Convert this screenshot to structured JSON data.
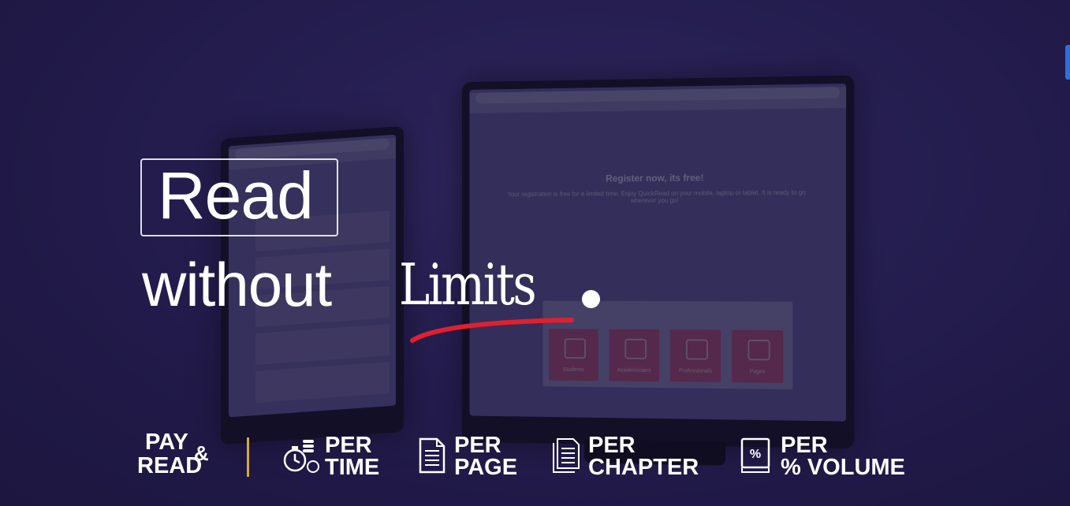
{
  "hero": {
    "headline_line1": "Read",
    "headline_word2": "without",
    "headline_word3": "Limits",
    "accent_color": "#e0202e"
  },
  "background_screens": {
    "left_monitor": {},
    "right_monitor": {
      "page_title": "Register now, its free!",
      "page_subtitle": "Your registration is free for a limited time. Enjoy QuickRead on your mobile, laptop or tablet. It is ready to go wherever you go!",
      "tiles": [
        "Students",
        "Academicians",
        "Professionals",
        "Pages"
      ],
      "tile_color": "#c4537f"
    }
  },
  "pricing_badges": {
    "pay_read": {
      "line1": "PAY",
      "amp": "&",
      "line2": "READ"
    },
    "divider_color": "#d6a93a",
    "items": [
      {
        "icon": "stopwatch-coins-icon",
        "line1": "PER",
        "line2": "TIME"
      },
      {
        "icon": "page-icon",
        "line1": "PER",
        "line2": "PAGE"
      },
      {
        "icon": "chapter-icon",
        "line1": "PER",
        "line2": "CHAPTER"
      },
      {
        "icon": "percent-book-icon",
        "line1": "PER",
        "line2": "% VOLUME"
      }
    ]
  }
}
